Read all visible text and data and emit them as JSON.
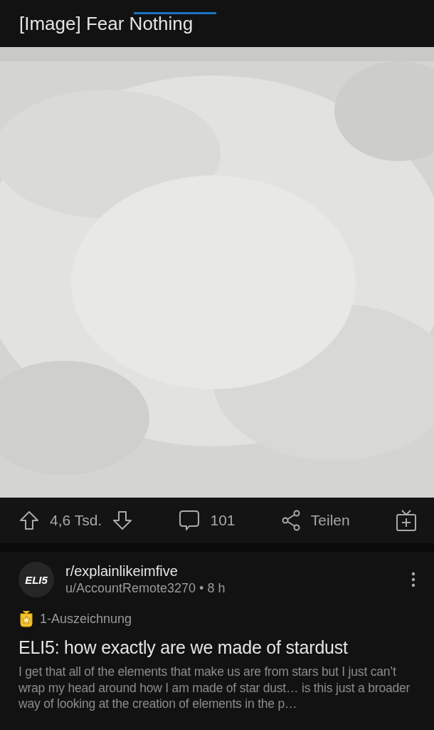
{
  "header": {
    "title": "[Image] Fear Nothing"
  },
  "actions": {
    "upvotes": "4,6 Tsd.",
    "comments": "101",
    "share": "Teilen"
  },
  "next_post": {
    "avatar": "ELI5",
    "subreddit": "r/explainlikeimfive",
    "meta": "u/AccountRemote3270 • 8 h",
    "award": "1-Auszeichnung",
    "title": "ELI5: how exactly are we made of stardust",
    "body": "I get that all of the elements that make us are from stars but I just can’t wrap my head around how I am made of star dust… is this just a broader way of looking at the creation of elements in the p…"
  }
}
